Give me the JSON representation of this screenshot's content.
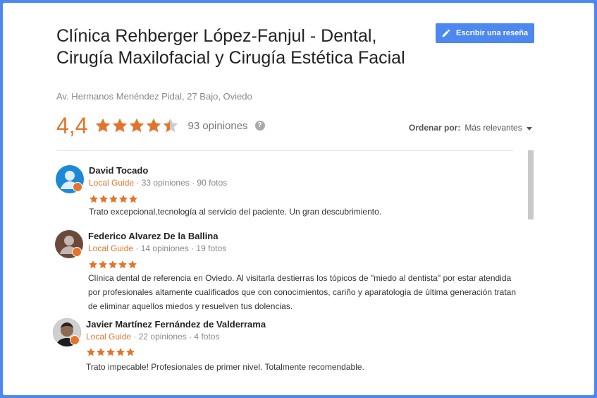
{
  "business": {
    "title": "Clínica Rehberger López-Fanjul - Dental, Cirugía Maxilofacial y Cirugía Estética Facial",
    "address": "Av. Hermanos Menéndez Pidal, 27 Bajo, Oviedo",
    "rating": "4,4",
    "rating_value": 4.4,
    "review_count": "93 opiniones"
  },
  "actions": {
    "write_review": "Escribir una reseña"
  },
  "sort": {
    "label": "Ordenar por:",
    "value": "Más relevantes"
  },
  "colors": {
    "accent": "#e3752b",
    "brand": "#4d87f0"
  },
  "icons": {
    "write": "pencil-icon",
    "help": "help-icon",
    "sort": "caret-down-icon",
    "rating": "star-icon"
  },
  "reviews": [
    {
      "author": "David Tocado",
      "local_guide": "Local Guide",
      "meta": " · 33 opiniones · 90 fotos",
      "rating": 5,
      "text": "Trato excepcional,tecnología al servicio del paciente. Un gran descubrimiento."
    },
    {
      "author": "Federico Alvarez De la Ballina",
      "local_guide": "Local Guide",
      "meta": " · 14 opiniones · 19 fotos",
      "rating": 5,
      "text": "Clínica dental de referencia en Oviedo.  Al visitarla destierras los tópicos de \"miedo al dentista\"  por estar atendida por profesionales altamente cualificados que con conocimientos, cariño y aparatologia de última generación tratan de eliminar aquellos miedos y resuelven tus dolencias."
    },
    {
      "author": "Javier Martínez Fernández de Valderrama",
      "local_guide": "Local Guide",
      "meta": " · 22 opiniones · 4 fotos",
      "rating": 5,
      "text": "Trato impecable! Profesionales de primer nivel. Totalmente recomendable."
    }
  ]
}
